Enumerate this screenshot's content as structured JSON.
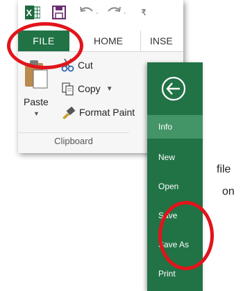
{
  "ribbon": {
    "tabs": {
      "file": "FILE",
      "home": "HOME",
      "insert": "INSE"
    },
    "qat_more": "₹",
    "clipboard": {
      "paste": "Paste",
      "cut": "Cut",
      "copy": "Copy",
      "format_painter": "Format Paint",
      "group_label": "Clipboard"
    }
  },
  "partial_text": [
    "file",
    "on"
  ],
  "backstage": {
    "items": [
      {
        "label": "Info",
        "active": true
      },
      {
        "label": "New"
      },
      {
        "label": "Open"
      },
      {
        "label": "Save"
      },
      {
        "label": "Save As"
      },
      {
        "label": "Print"
      }
    ]
  },
  "colors": {
    "excel_green": "#217346",
    "active_item": "#439467",
    "highlight_red": "#e2141b"
  }
}
